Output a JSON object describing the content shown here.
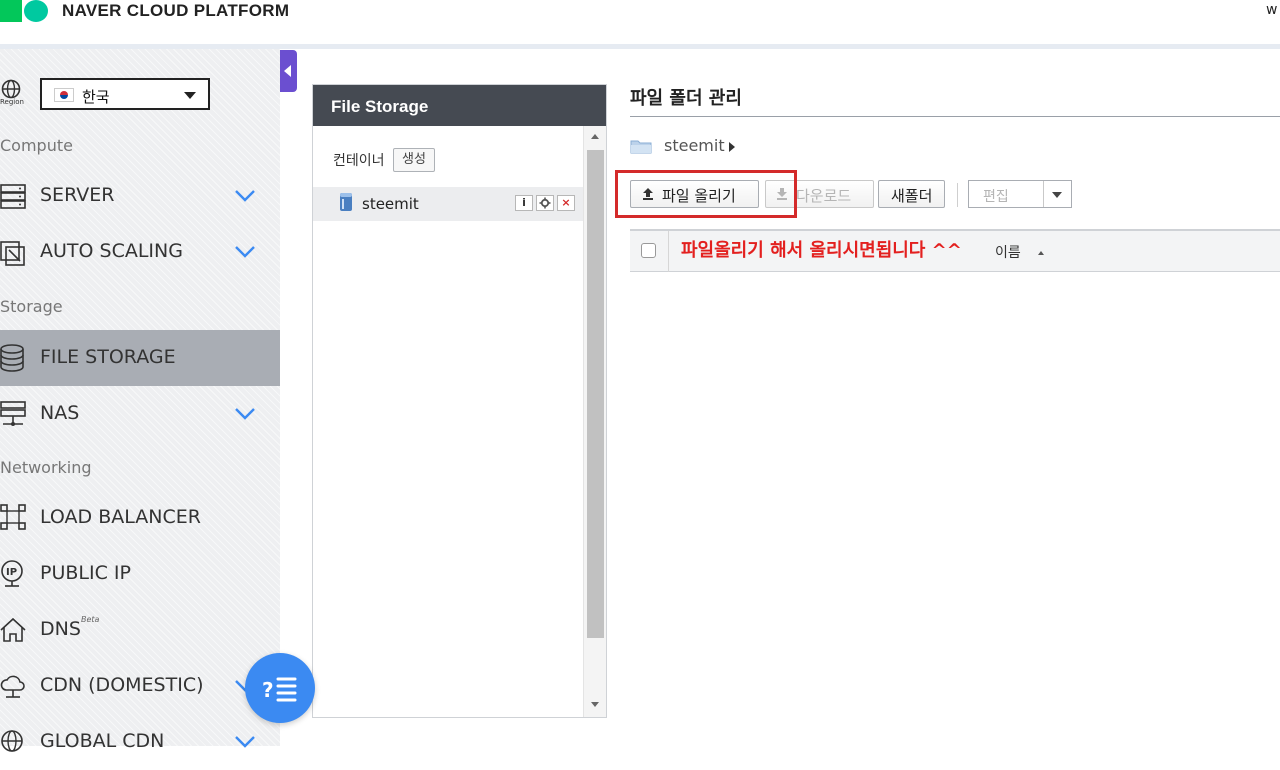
{
  "header": {
    "brand": "NAVER CLOUD PLATFORM",
    "user_initial": "w"
  },
  "sidebar": {
    "region_label": "Region",
    "region_value": "한국",
    "sections": {
      "compute": "Compute",
      "storage": "Storage",
      "networking": "Networking"
    },
    "items": [
      {
        "label": "SERVER",
        "icon": "server-icon",
        "expandable": true
      },
      {
        "label": "AUTO SCALING",
        "icon": "auto-scaling-icon",
        "expandable": true
      },
      {
        "label": "FILE STORAGE",
        "icon": "database-icon",
        "active": true
      },
      {
        "label": "NAS",
        "icon": "nas-icon",
        "expandable": true
      },
      {
        "label": "LOAD BALANCER",
        "icon": "load-balancer-icon"
      },
      {
        "label": "PUBLIC IP",
        "icon": "public-ip-icon"
      },
      {
        "label": "DNS",
        "badge": "Beta",
        "icon": "home-icon"
      },
      {
        "label": "CDN (DOMESTIC)",
        "icon": "cloud-icon",
        "expandable": true
      },
      {
        "label": "GLOBAL CDN",
        "icon": "globe-icon",
        "expandable": true
      }
    ]
  },
  "file_storage": {
    "title": "File Storage",
    "container_label": "컨테이너",
    "create_button": "생성",
    "containers": [
      {
        "name": "steemit",
        "info": "i",
        "delete": "×"
      }
    ]
  },
  "main": {
    "title": "파일 폴더 관리",
    "breadcrumb": "steemit",
    "toolbar": {
      "upload": "파일 올리기",
      "download": "다운로드",
      "new_folder": "새폴더",
      "edit": "편집"
    },
    "table": {
      "name_column": "이름"
    },
    "annotation": "파일올리기 해서 올리시면됩니다 ^^"
  },
  "colors": {
    "accent": "#3b8af2",
    "highlight": "#d42a2a",
    "panel_header": "#454a52",
    "active_nav": "#a9adb4"
  }
}
